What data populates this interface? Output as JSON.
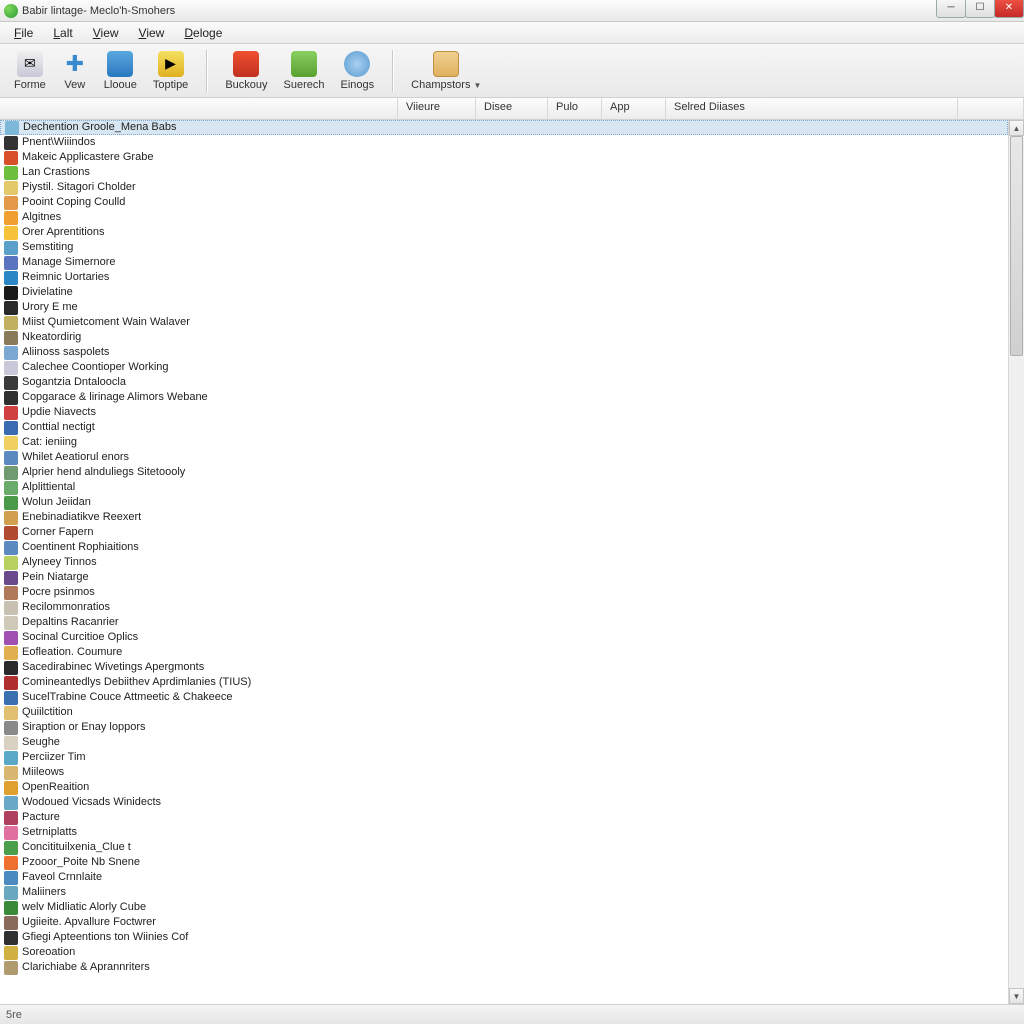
{
  "window": {
    "title": "Babir lintage- Meclo'h-Smohers"
  },
  "menu": {
    "file": "File",
    "lalt": "Lalt",
    "view1": "View",
    "view2": "View",
    "deloge": "Deloge"
  },
  "toolbar": {
    "forme": "Forme",
    "vew": "Vew",
    "llooue": "Llooue",
    "toptipe": "Toptipe",
    "buckouy": "Buckouy",
    "suerech": "Suerech",
    "einogs": "Einogs",
    "champstors": "Champstors"
  },
  "columns": {
    "c0": "",
    "c1": "Viieure",
    "c2": "Disee",
    "c3": "Pulo",
    "c4": "App",
    "c5": "Selred Diiases"
  },
  "items": [
    {
      "label": "Dechention Groole_Mena Babs",
      "icon": "#7db8d8",
      "selected": true
    },
    {
      "label": "Pnent\\Wiiindos",
      "icon": "#333333"
    },
    {
      "label": "Makeic Applicastere Grabe",
      "icon": "#d94f2a"
    },
    {
      "label": "Lan Crastions",
      "icon": "#6fbf3f"
    },
    {
      "label": "Piystil. Sitagori Cholder",
      "icon": "#e4c96a"
    },
    {
      "label": "Pooint Coping Coulld",
      "icon": "#e29a4a"
    },
    {
      "label": "Algitnes",
      "icon": "#f0a030"
    },
    {
      "label": "Orer Aprentitions",
      "icon": "#f5c23a"
    },
    {
      "label": "Semstiting",
      "icon": "#5aa0c8"
    },
    {
      "label": "Manage Simernore",
      "icon": "#5a74c0"
    },
    {
      "label": "Reimnic Uortaries",
      "icon": "#2a86c4"
    },
    {
      "label": "Divielatine",
      "icon": "#1a1a1a"
    },
    {
      "label": "Urory E me",
      "icon": "#2a2a2a"
    },
    {
      "label": "Miist Qumietcoment Wain Walaver",
      "icon": "#c0b060"
    },
    {
      "label": "Nkeatordirig",
      "icon": "#8a7a5a"
    },
    {
      "label": "Aliinoss saspolets",
      "icon": "#7aa8d2"
    },
    {
      "label": "Calechee Coontioper Working",
      "icon": "#c8c8d8"
    },
    {
      "label": "Sogantzia Dntaloocla",
      "icon": "#3a3a3a"
    },
    {
      "label": "Copgarace & lirinage Alimors Webane",
      "icon": "#303030"
    },
    {
      "label": "Updie Niavects",
      "icon": "#d04040"
    },
    {
      "label": "Conttial nectigt",
      "icon": "#3a6ab0"
    },
    {
      "label": "Cat: ieniing",
      "icon": "#f0d060"
    },
    {
      "label": "Whilet Aeatiorul enors",
      "icon": "#5a8abf"
    },
    {
      "label": "Alprier hend alnduliegs Sitetoooly",
      "icon": "#709a70"
    },
    {
      "label": "Alplittiental",
      "icon": "#6aaa6a"
    },
    {
      "label": "Wolun Jeiidan",
      "icon": "#4a9a4a"
    },
    {
      "label": "Enebinadiatikve Reexert",
      "icon": "#d0a050"
    },
    {
      "label": "Corner Fapern",
      "icon": "#b04a30"
    },
    {
      "label": "Coentinent Rophiaitions",
      "icon": "#5a8abf"
    },
    {
      "label": "Alyneey Tinnos",
      "icon": "#b8d060"
    },
    {
      "label": "Pein Niatarge",
      "icon": "#6a4a8a"
    },
    {
      "label": "Pocre psinmos",
      "icon": "#b07a5a"
    },
    {
      "label": "Recilommonratios",
      "icon": "#c8c0b0"
    },
    {
      "label": "Depaltins Racanrier",
      "icon": "#d0c8b8"
    },
    {
      "label": "Socinal Curcitioe Oplics",
      "icon": "#a050b0"
    },
    {
      "label": "Eofleation. Coumure",
      "icon": "#e0b050"
    },
    {
      "label": "Sacedirabinec Wivetings Apergmonts",
      "icon": "#2a2a2a"
    },
    {
      "label": "Comineantedlys Debiithev Aprdimlanies (TIUS)",
      "icon": "#b03030"
    },
    {
      "label": "SucelTrabine Couce Attmeetic & Chakeece",
      "icon": "#3a70b0"
    },
    {
      "label": "Quiilctition",
      "icon": "#e0c070"
    },
    {
      "label": "Siraption or Enay loppors",
      "icon": "#8a8a8a"
    },
    {
      "label": "Seughe",
      "icon": "#d8d0c0"
    },
    {
      "label": "Perciizer Tim",
      "icon": "#5aa8c8"
    },
    {
      "label": "Miileows",
      "icon": "#d8b870"
    },
    {
      "label": "OpenReaition",
      "icon": "#e0a030"
    },
    {
      "label": "Wodoued Vicsads Winidects",
      "icon": "#6aa8c8"
    },
    {
      "label": "Pacture",
      "icon": "#b04060"
    },
    {
      "label": "Setrniplatts",
      "icon": "#e070a0"
    },
    {
      "label": "Concitituilxenia_Clue t",
      "icon": "#4aa04a"
    },
    {
      "label": "Pzooor_Poite Nb Snene",
      "icon": "#f07030"
    },
    {
      "label": "Faveol Crnnlaite",
      "icon": "#4a8ac0"
    },
    {
      "label": "Maliiners",
      "icon": "#6aa8c0"
    },
    {
      "label": "welv Midliatic Alorly Cube",
      "icon": "#3a8a3a"
    },
    {
      "label": "Ugiieite. Apvallure Foctwrer",
      "icon": "#8a6a5a"
    },
    {
      "label": "Gfiegi Apteentions ton Wiinies Cof",
      "icon": "#303030"
    },
    {
      "label": "Soreoation",
      "icon": "#d0b040"
    },
    {
      "label": "Clarichiabe & Aprannriters",
      "icon": "#b09a70"
    }
  ],
  "status": {
    "text": "5re"
  }
}
